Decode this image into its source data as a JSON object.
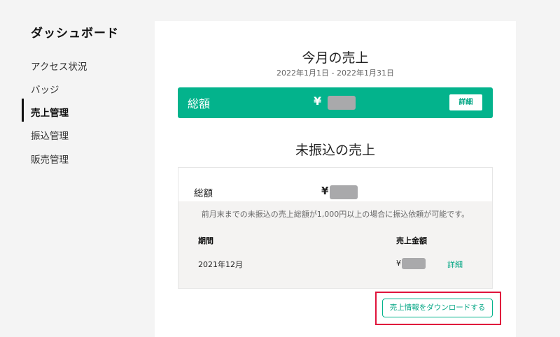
{
  "sidebar": {
    "title": "ダッシュボード",
    "items": [
      {
        "label": "アクセス状況"
      },
      {
        "label": "バッジ"
      },
      {
        "label": "売上管理",
        "active": true
      },
      {
        "label": "振込管理"
      },
      {
        "label": "販売管理"
      }
    ]
  },
  "monthly": {
    "title": "今月の売上",
    "period": "2022年1月1日 - 2022年1月31日",
    "total_label": "総額",
    "currency": "¥",
    "detail_label": "詳細"
  },
  "unpaid": {
    "title": "未振込の売上",
    "total_label": "総額",
    "currency": "¥",
    "note": "前月末までの未振込の売上総額が1,000円以上の場合に振込依頼が可能です。",
    "columns": [
      "期間",
      "売上金額"
    ],
    "rows": [
      {
        "period": "2021年12月",
        "currency": "¥",
        "link": "詳細"
      }
    ]
  },
  "download_label": "売上情報をダウンロードする",
  "colors": {
    "accent": "#03b38c",
    "highlight": "#e0143c",
    "mask": "#a9a9ab"
  }
}
